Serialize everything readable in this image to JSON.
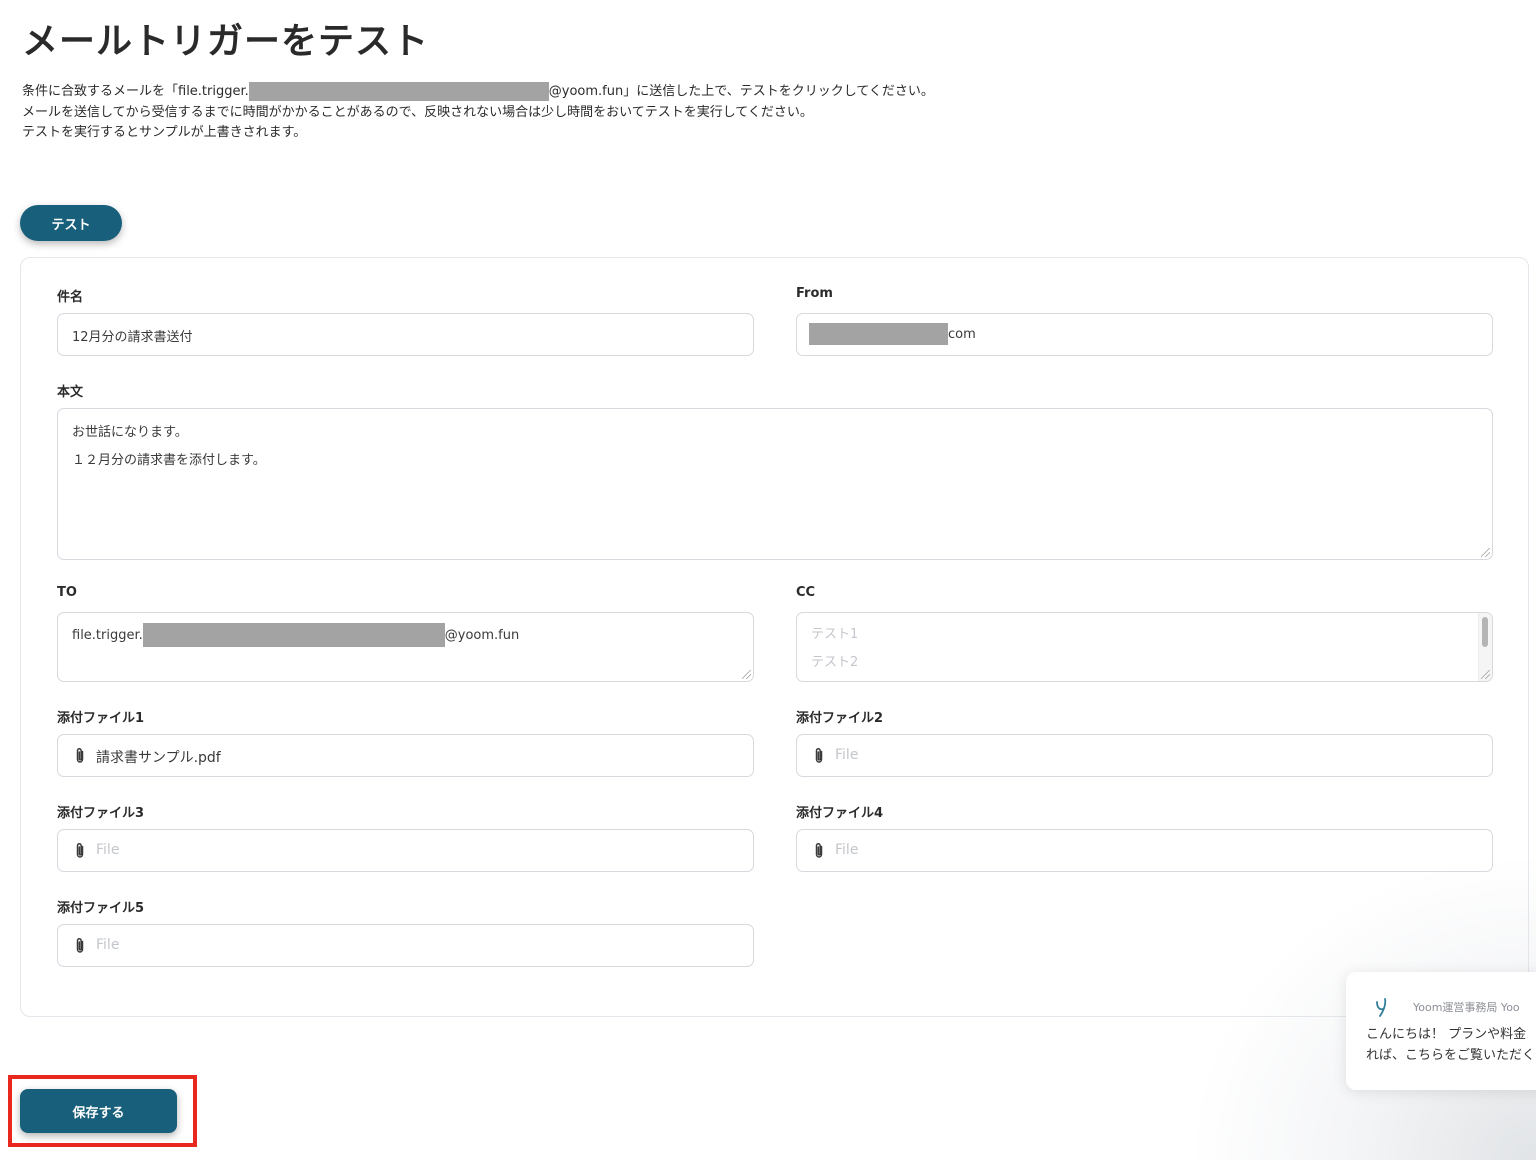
{
  "page": {
    "title": "メールトリガーをテスト",
    "instructions": {
      "line1_prefix": "条件に合致するメールを「file.trigger.",
      "line1_suffix": "@yoom.fun」に送信した上で、テストをクリックしてください。",
      "line2": "メールを送信してから受信するまでに時間がかかることがあるので、反映されない場合は少し時間をおいてテストを実行してください。",
      "line3": "テストを実行するとサンプルが上書きされます。"
    },
    "test_button_label": "テスト",
    "save_button_label": "保存する"
  },
  "form": {
    "subject": {
      "label": "件名",
      "value": "12月分の請求書送付"
    },
    "from": {
      "label": "From",
      "value_suffix": "com"
    },
    "body": {
      "label": "本文",
      "lines": [
        "お世話になります。",
        "１２月分の請求書を添付します。"
      ]
    },
    "to": {
      "label": "TO",
      "value_prefix": "file.trigger.",
      "value_suffix": "@yoom.fun"
    },
    "cc": {
      "label": "CC",
      "placeholder_lines": [
        "テスト1",
        "テスト2"
      ]
    },
    "attachments": [
      {
        "label": "添付ファイル1",
        "value": "請求書サンプル.pdf",
        "placeholder": "File"
      },
      {
        "label": "添付ファイル2",
        "value": "",
        "placeholder": "File"
      },
      {
        "label": "添付ファイル3",
        "value": "",
        "placeholder": "File"
      },
      {
        "label": "添付ファイル4",
        "value": "",
        "placeholder": "File"
      },
      {
        "label": "添付ファイル5",
        "value": "",
        "placeholder": "File"
      }
    ]
  },
  "chat": {
    "sender": "Yoom運営事務局 Yoo",
    "message_line1": "こんにちは！ プランや料金",
    "message_line2": "れば、こちらをご覧いただく"
  },
  "colors": {
    "primary": "#175f7a",
    "highlight": "#e8281f",
    "redaction": "#a3a3a3"
  },
  "icons": {
    "attachment": "paperclip-icon",
    "chat_logo": "yoom-logo-icon"
  }
}
